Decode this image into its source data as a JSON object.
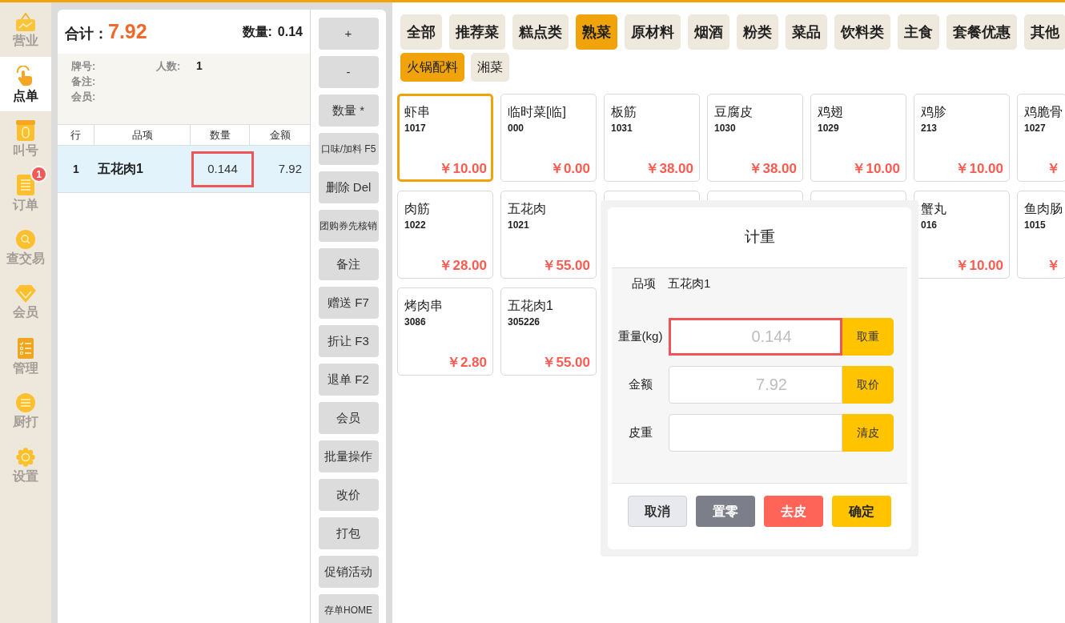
{
  "nav": [
    {
      "label": "营业",
      "selected": false
    },
    {
      "label": "点单",
      "selected": true
    },
    {
      "label": "叫号",
      "selected": false
    },
    {
      "label": "订单",
      "selected": false,
      "badge": "1"
    },
    {
      "label": "查交易",
      "selected": false
    },
    {
      "label": "会员",
      "selected": false
    },
    {
      "label": "管理",
      "selected": false
    },
    {
      "label": "厨打",
      "selected": false
    },
    {
      "label": "设置",
      "selected": false
    }
  ],
  "order": {
    "total_label": "合计：",
    "total": "7.92",
    "quantity_label": "数量:",
    "quantity": "0.14",
    "info": {
      "table_label": "牌号:",
      "guests_label": "人数:",
      "guests": "1",
      "note_label": "备注:",
      "member_label": "会员:"
    },
    "columns": [
      "行",
      "品项",
      "数量",
      "金额"
    ],
    "rows": [
      {
        "line": "1",
        "item": "五花肉1",
        "quantity": "0.144",
        "amount": "7.92",
        "selected": true,
        "quantity_highlighted": true
      }
    ]
  },
  "actions": [
    "+",
    "-",
    "数量 *",
    "口味/加料 F5",
    "删除 Del",
    "团购券先核销",
    "备注",
    "赠送 F7",
    "折让 F3",
    "退单 F2",
    "会员",
    "批量操作",
    "改价",
    "打包",
    "促销活动",
    "存单HOME"
  ],
  "categories": [
    {
      "label": "全部",
      "selected": false
    },
    {
      "label": "推荐菜",
      "selected": false
    },
    {
      "label": "糕点类",
      "selected": false
    },
    {
      "label": "熟菜",
      "selected": true
    },
    {
      "label": "原材料",
      "selected": false
    },
    {
      "label": "烟酒",
      "selected": false
    },
    {
      "label": "粉类",
      "selected": false
    },
    {
      "label": "菜品",
      "selected": false
    },
    {
      "label": "饮料类",
      "selected": false
    },
    {
      "label": "主食",
      "selected": false
    },
    {
      "label": "套餐优惠",
      "selected": false
    },
    {
      "label": "其他",
      "selected": false
    }
  ],
  "subcategories": [
    {
      "label": "火锅配料",
      "selected": true
    },
    {
      "label": "湘菜",
      "selected": false
    }
  ],
  "products": [
    {
      "name": "虾串",
      "code": "1017",
      "price": "￥10.00",
      "selected": true
    },
    {
      "name": "临时菜[临]",
      "code": "000",
      "price": "￥0.00",
      "selected": false
    },
    {
      "name": "板筋",
      "code": "1031",
      "price": "￥38.00",
      "selected": false
    },
    {
      "name": "豆腐皮",
      "code": "1030",
      "price": "￥38.00",
      "selected": false
    },
    {
      "name": "鸡翅",
      "code": "1029",
      "price": "￥10.00",
      "selected": false
    },
    {
      "name": "鸡胗",
      "code": "213",
      "price": "￥10.00",
      "selected": false
    },
    {
      "name": "鸡脆骨",
      "code": "1027",
      "price": "￥",
      "selected": false
    },
    {
      "name": "肉筋",
      "code": "1022",
      "price": "￥28.00",
      "selected": false
    },
    {
      "name": "五花肉",
      "code": "1021",
      "price": "￥55.00",
      "selected": false
    },
    {
      "selected": false
    },
    {
      "selected": false
    },
    {
      "selected": false
    },
    {
      "name": "蟹丸",
      "code": "016",
      "price": "￥10.00",
      "selected": false
    },
    {
      "name": "鱼肉肠",
      "code": "1015",
      "price": "￥",
      "selected": false
    },
    {
      "name": "烤肉串",
      "code": "3086",
      "price": "￥2.80",
      "selected": false
    },
    {
      "name": "五花肉1",
      "code": "305226",
      "price": "￥55.00",
      "selected": false
    }
  ],
  "dialog": {
    "title": "计重",
    "item_label": "品项",
    "item": "五花肉1",
    "fields": [
      {
        "label": "重量(kg)",
        "value": "0.144",
        "button": "取重",
        "highlighted": true
      },
      {
        "label": "金额",
        "value": "7.92",
        "button": "取价",
        "highlighted": false
      },
      {
        "label": "皮重",
        "button": "清皮",
        "highlighted": false
      }
    ],
    "buttons": [
      {
        "label": "取消",
        "kind": "cancel"
      },
      {
        "label": "置零",
        "kind": "zero"
      },
      {
        "label": "去皮",
        "kind": "tare"
      },
      {
        "label": "确定",
        "kind": "confirm"
      }
    ]
  }
}
